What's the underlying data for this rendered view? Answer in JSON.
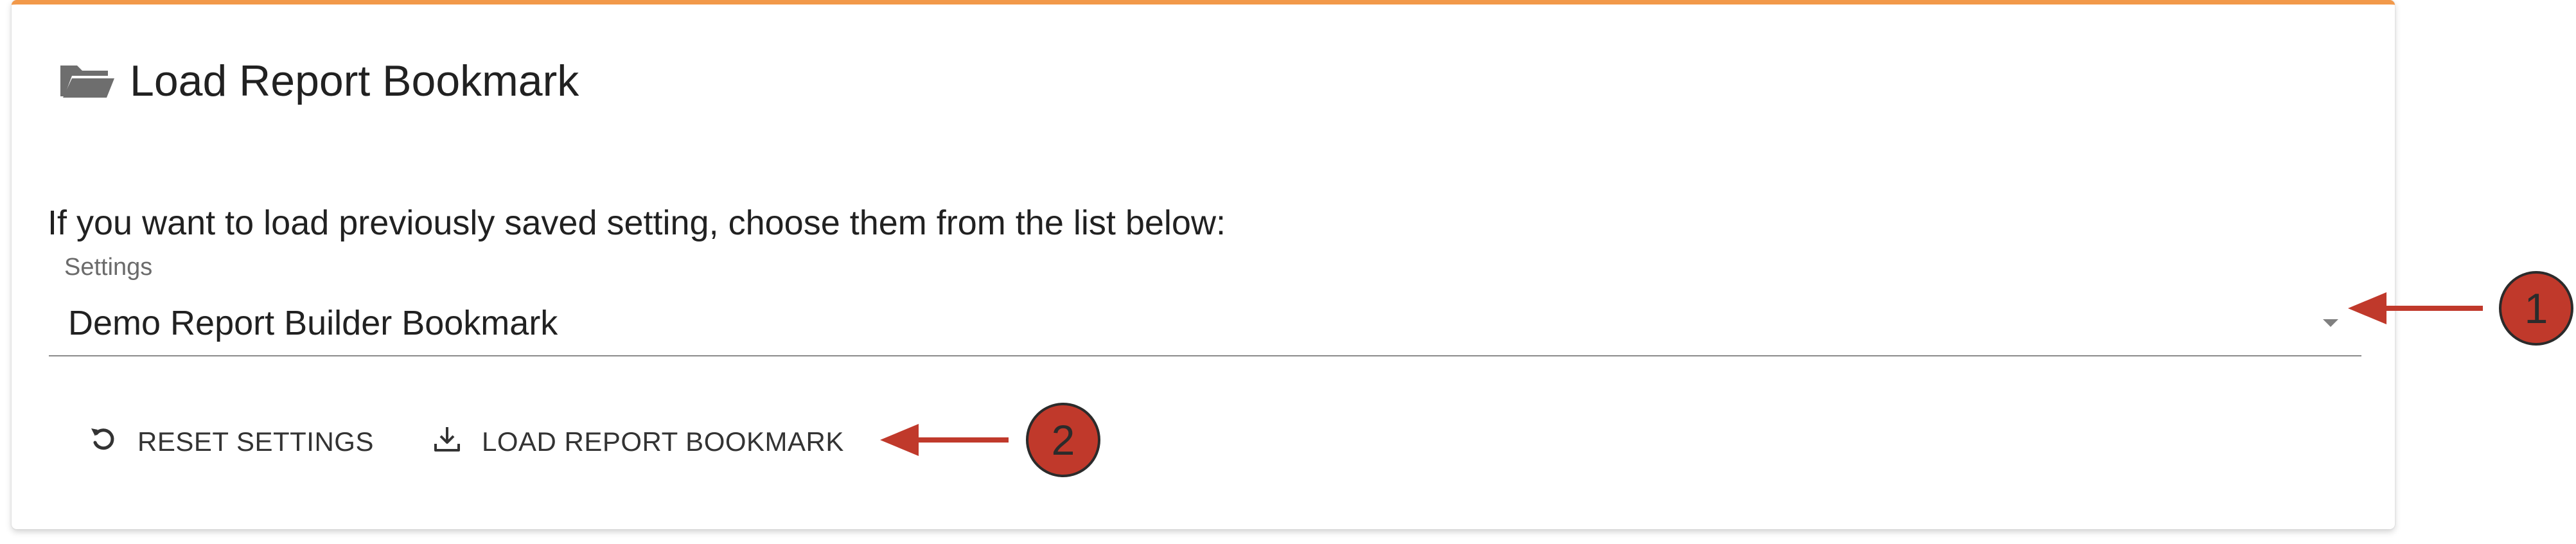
{
  "card": {
    "accent_color": "#f2994a",
    "title": "Load Report Bookmark",
    "title_icon": "folder-open-icon"
  },
  "instruction": "If you want to load previously saved setting, choose them from the list below:",
  "settings_field": {
    "label": "Settings",
    "selected_value": "Demo Report Builder Bookmark"
  },
  "actions": {
    "reset_label": "RESET SETTINGS",
    "reset_icon": "undo-icon",
    "load_label": "LOAD REPORT BOOKMARK",
    "load_icon": "download-icon"
  },
  "annotations": [
    {
      "number": "1",
      "color": "#c0392b"
    },
    {
      "number": "2",
      "color": "#c0392b"
    }
  ]
}
